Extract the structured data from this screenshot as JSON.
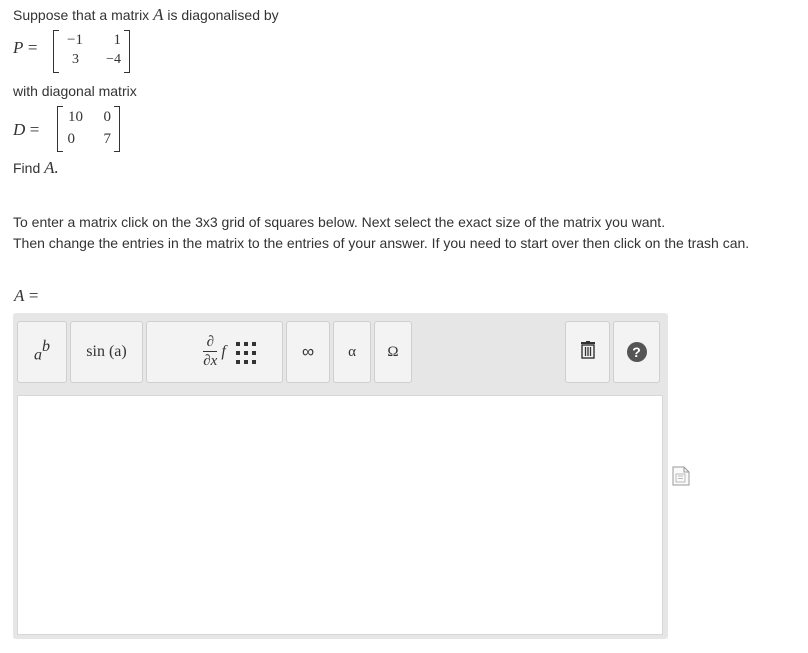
{
  "question": {
    "intro": "Suppose that a matrix",
    "intro_var": "A",
    "intro_end": "is diagonalised by",
    "p_label": "P",
    "equals": "=",
    "P": [
      [
        "−1",
        "1"
      ],
      [
        "3",
        "−4"
      ]
    ],
    "with_diag": "with diagonal matrix",
    "d_label": "D",
    "D": [
      [
        "10",
        "0"
      ],
      [
        "0",
        "7"
      ]
    ],
    "find": "Find",
    "find_var": "A.",
    "instruction_line1": "To enter a matrix click on the 3x3 grid of squares below. Next select the exact size of the matrix you want.",
    "instruction_line2": "Then change the entries in the matrix to the entries of your answer. If you need to start over then click on the trash can.",
    "answer_label": "A",
    "answer_equals": "="
  },
  "toolbar": {
    "power_base": "a",
    "power_exp": "b",
    "sin_label": "sin (a)",
    "deriv_num": "∂",
    "deriv_den": "∂x",
    "deriv_f": "f",
    "infinity": "∞",
    "alpha": "α",
    "omega": "Ω",
    "help": "?"
  },
  "colors": {
    "toolbar_bg": "#e6e6e6",
    "button_bg": "#f3f3f3",
    "help_circle": "#555555"
  }
}
